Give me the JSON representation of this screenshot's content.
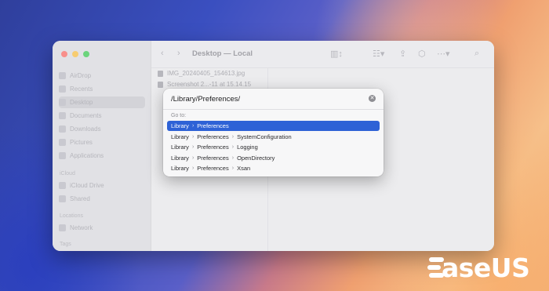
{
  "wallpaper": {
    "colors": [
      "#2f3f9c",
      "#c87a8a",
      "#f6c08a"
    ]
  },
  "finder": {
    "title": "Desktop — Local",
    "traffic_colors": {
      "close": "#ff5f57",
      "minimize": "#febc2e",
      "zoom": "#28c840"
    },
    "sidebar": {
      "favorites": [
        {
          "label": "AirDrop",
          "icon": "airdrop-icon"
        },
        {
          "label": "Recents",
          "icon": "clock-icon"
        },
        {
          "label": "Desktop",
          "icon": "desktop-icon",
          "selected": true
        },
        {
          "label": "Documents",
          "icon": "document-icon"
        },
        {
          "label": "Downloads",
          "icon": "download-icon"
        },
        {
          "label": "Pictures",
          "icon": "pictures-icon"
        },
        {
          "label": "Applications",
          "icon": "applications-icon"
        }
      ],
      "icloud_header": "iCloud",
      "icloud": [
        {
          "label": "iCloud Drive",
          "icon": "cloud-icon"
        },
        {
          "label": "Shared",
          "icon": "shared-folder-icon"
        }
      ],
      "locations_header": "Locations",
      "locations": [
        {
          "label": "Network",
          "icon": "globe-icon"
        }
      ],
      "tags_header": "Tags"
    },
    "files": [
      {
        "name": "IMG_20240405_154613.jpg"
      },
      {
        "name": "Screenshot 2...-11 at 15.14.15"
      }
    ]
  },
  "goto": {
    "input_value": "/Library/Preferences/",
    "section_label": "Go to:",
    "suggestions": [
      {
        "parts": [
          "Library",
          "Preferences"
        ],
        "selected": true
      },
      {
        "parts": [
          "Library",
          "Preferences",
          "SystemConfiguration"
        ],
        "selected": false
      },
      {
        "parts": [
          "Library",
          "Preferences",
          "Logging"
        ],
        "selected": false
      },
      {
        "parts": [
          "Library",
          "Preferences",
          "OpenDirectory"
        ],
        "selected": false
      },
      {
        "parts": [
          "Library",
          "Preferences",
          "Xsan"
        ],
        "selected": false
      }
    ],
    "accent": "#2e62d6"
  },
  "watermark": {
    "brand": "EaseUS",
    "text": "aseUS"
  }
}
